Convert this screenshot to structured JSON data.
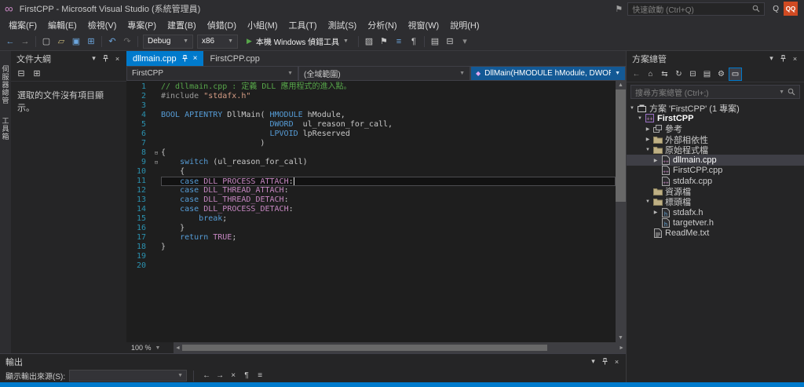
{
  "colors": {
    "accent": "#007ACC",
    "active_tab": "#007ACC",
    "editor_bg": "#1E1E1E",
    "panel_bg": "#252526",
    "statusbar": "#007ACC",
    "current_line_border": "#4D4D50"
  },
  "title_bar": {
    "title": "FirstCPP - Microsoft Visual Studio (系統管理員)",
    "flag_icon": "⚑",
    "quick_launch_placeholder": "快速啟動 (Ctrl+Q)",
    "account_initial": "Q",
    "account_badge": "QQ"
  },
  "menu_bar": {
    "items": [
      "檔案(F)",
      "編輯(E)",
      "檢視(V)",
      "專案(P)",
      "建置(B)",
      "偵錯(D)",
      "小組(M)",
      "工具(T)",
      "測試(S)",
      "分析(N)",
      "視窗(W)",
      "說明(H)"
    ]
  },
  "toolbar": {
    "icons_left": [
      {
        "name": "navigate-back-icon",
        "glyph": "←",
        "color": "#6CA6DE"
      },
      {
        "name": "navigate-forward-icon",
        "glyph": "→",
        "color": "#8A8A8A"
      },
      {
        "name": "sep"
      },
      {
        "name": "new-file-icon",
        "glyph": "▢",
        "color": "#C8C8C8"
      },
      {
        "name": "open-file-icon",
        "glyph": "▱",
        "color": "#C8B87A"
      },
      {
        "name": "save-icon",
        "glyph": "▣",
        "color": "#6CA6DE"
      },
      {
        "name": "save-all-icon",
        "glyph": "⊞",
        "color": "#6CA6DE"
      },
      {
        "name": "sep"
      },
      {
        "name": "undo-icon",
        "glyph": "↶",
        "color": "#6CA6DE"
      },
      {
        "name": "redo-icon",
        "glyph": "↷",
        "color": "#6A6A6A"
      },
      {
        "name": "sep"
      }
    ],
    "config_value": "Debug",
    "platform_value": "x86",
    "run_label": "本機 Windows 偵錯工具",
    "icons_right": [
      {
        "name": "sep"
      },
      {
        "name": "find-in-files-icon",
        "glyph": "▨",
        "color": "#C8C8C8"
      },
      {
        "name": "bookmark-icon",
        "glyph": "⚑",
        "color": "#C8C8C8"
      },
      {
        "name": "comment-lines-icon",
        "glyph": "≡",
        "color": "#6CA6DE"
      },
      {
        "name": "formatting-icon",
        "glyph": "¶",
        "color": "#C8C8C8"
      },
      {
        "name": "sep"
      },
      {
        "name": "solution-explorer-tool-icon",
        "glyph": "▤",
        "color": "#C8C8C8"
      },
      {
        "name": "properties-window-icon",
        "glyph": "⊟",
        "color": "#C8C8C8"
      },
      {
        "name": "toolbar-overflow-icon",
        "glyph": "▾",
        "color": "#8A8A8A"
      }
    ]
  },
  "autohide": {
    "items": [
      {
        "label": "伺服器總管"
      },
      {
        "label": "工具箱"
      }
    ]
  },
  "document_outline": {
    "title": "文件大綱",
    "toolbar_icons": [
      {
        "name": "collapse-all-icon",
        "glyph": "⊟",
        "color": "#C8C8C8"
      },
      {
        "name": "expand-all-icon",
        "glyph": "⊞",
        "color": "#C8C8C8"
      }
    ],
    "empty_message": "選取的文件沒有項目顯示。"
  },
  "editor": {
    "tabs": [
      {
        "label": "dllmain.cpp",
        "active": true
      },
      {
        "label": "FirstCPP.cpp",
        "active": false
      }
    ],
    "navbar": {
      "project": "FirstCPP",
      "scope": "(全域範圍)",
      "member": "DllMain(HMODULE hModule, DWORD ul_rea"
    },
    "zoom_level": "100 %",
    "code": [
      {
        "n": 1,
        "s": [
          {
            "c": "cm",
            "t": "// dllmain.cpp : 定義 DLL 應用程式的進入點。"
          }
        ]
      },
      {
        "n": 2,
        "s": [
          {
            "c": "pp",
            "t": "#include "
          },
          {
            "c": "str",
            "t": "\"stdafx.h\""
          }
        ]
      },
      {
        "n": 3,
        "s": []
      },
      {
        "n": 4,
        "s": [
          {
            "c": "kw",
            "t": "BOOL APIENTRY "
          },
          {
            "c": "pl",
            "t": "DllMain( "
          },
          {
            "c": "kw",
            "t": "HMODULE"
          },
          {
            "c": "pl",
            "t": " hModule,"
          }
        ]
      },
      {
        "n": 5,
        "s": [
          {
            "c": "pl",
            "t": "                       "
          },
          {
            "c": "kw",
            "t": "DWORD"
          },
          {
            "c": "pl",
            "t": "  ul_reason_for_call,"
          }
        ]
      },
      {
        "n": 6,
        "s": [
          {
            "c": "pl",
            "t": "                       "
          },
          {
            "c": "kw",
            "t": "LPVOID"
          },
          {
            "c": "pl",
            "t": " lpReserved"
          }
        ]
      },
      {
        "n": 7,
        "s": [
          {
            "c": "pl",
            "t": "                     )"
          }
        ]
      },
      {
        "n": 8,
        "fold": true,
        "s": [
          {
            "c": "pl",
            "t": "{"
          }
        ]
      },
      {
        "n": 9,
        "fold": true,
        "s": [
          {
            "c": "pl",
            "t": "    "
          },
          {
            "c": "kw",
            "t": "switch"
          },
          {
            "c": "pl",
            "t": " (ul_reason_for_call)"
          }
        ]
      },
      {
        "n": 10,
        "s": [
          {
            "c": "pl",
            "t": "    {"
          }
        ]
      },
      {
        "n": 11,
        "cur": true,
        "s": [
          {
            "c": "pl",
            "t": "    "
          },
          {
            "c": "kw",
            "t": "case"
          },
          {
            "c": "pl",
            "t": " "
          },
          {
            "c": "mc",
            "t": "DLL_PROCESS_ATTACH"
          },
          {
            "c": "pl",
            "t": ":"
          }
        ]
      },
      {
        "n": 12,
        "s": [
          {
            "c": "pl",
            "t": "    "
          },
          {
            "c": "kw",
            "t": "case"
          },
          {
            "c": "pl",
            "t": " "
          },
          {
            "c": "mc",
            "t": "DLL_THREAD_ATTACH"
          },
          {
            "c": "pl",
            "t": ":"
          }
        ]
      },
      {
        "n": 13,
        "s": [
          {
            "c": "pl",
            "t": "    "
          },
          {
            "c": "kw",
            "t": "case"
          },
          {
            "c": "pl",
            "t": " "
          },
          {
            "c": "mc",
            "t": "DLL_THREAD_DETACH"
          },
          {
            "c": "pl",
            "t": ":"
          }
        ]
      },
      {
        "n": 14,
        "s": [
          {
            "c": "pl",
            "t": "    "
          },
          {
            "c": "kw",
            "t": "case"
          },
          {
            "c": "pl",
            "t": " "
          },
          {
            "c": "mc",
            "t": "DLL_PROCESS_DETACH"
          },
          {
            "c": "pl",
            "t": ":"
          }
        ]
      },
      {
        "n": 15,
        "s": [
          {
            "c": "pl",
            "t": "        "
          },
          {
            "c": "kw",
            "t": "break"
          },
          {
            "c": "pl",
            "t": ";"
          }
        ]
      },
      {
        "n": 16,
        "s": [
          {
            "c": "pl",
            "t": "    }"
          }
        ]
      },
      {
        "n": 17,
        "s": [
          {
            "c": "pl",
            "t": "    "
          },
          {
            "c": "kw",
            "t": "return"
          },
          {
            "c": "pl",
            "t": " "
          },
          {
            "c": "mc",
            "t": "TRUE"
          },
          {
            "c": "pl",
            "t": ";"
          }
        ]
      },
      {
        "n": 18,
        "s": [
          {
            "c": "pl",
            "t": "}"
          }
        ]
      },
      {
        "n": 19,
        "s": []
      },
      {
        "n": 20,
        "s": []
      }
    ]
  },
  "output": {
    "title": "輸出",
    "source_label": "顯示輸出來源(S):",
    "source_value": "",
    "icons": [
      {
        "name": "previous-message-icon",
        "glyph": "←",
        "color": "#C8C8C8"
      },
      {
        "name": "next-message-icon",
        "glyph": "→",
        "color": "#C8C8C8"
      },
      {
        "name": "clear-all-icon",
        "glyph": "×",
        "color": "#C8C8C8"
      },
      {
        "name": "word-wrap-icon",
        "glyph": "¶",
        "color": "#C8C8C8"
      },
      {
        "name": "toggle-autoscroll-icon",
        "glyph": "≡",
        "color": "#C8C8C8"
      }
    ]
  },
  "solution_explorer": {
    "title": "方案總管",
    "toolbar_icons": [
      {
        "name": "back-icon",
        "glyph": "←",
        "color": "#8A8A8A"
      },
      {
        "name": "home-icon",
        "glyph": "⌂",
        "color": "#C8C8C8"
      },
      {
        "name": "switch-views-icon",
        "glyph": "⇆",
        "color": "#C8C8C8"
      },
      {
        "name": "sync-with-active-document-icon",
        "glyph": "↻",
        "color": "#C8C8C8"
      },
      {
        "name": "collapse-all-icon",
        "glyph": "⊟",
        "color": "#C8C8C8"
      },
      {
        "name": "show-all-files-icon",
        "glyph": "▤",
        "color": "#C8C8C8"
      },
      {
        "name": "properties-icon",
        "glyph": "⚙",
        "color": "#C8C8C8"
      },
      {
        "name": "preview-selected-items-icon",
        "glyph": "▭",
        "color": "#FFFFFF",
        "pressed": true
      }
    ],
    "search_placeholder": "搜尋方案總管 (Ctrl+;)",
    "tree": [
      {
        "label": "方案 'FirstCPP' (1 專案)",
        "level": 0,
        "icon": "solution",
        "expand": "down"
      },
      {
        "label": "FirstCPP",
        "level": 1,
        "icon": "project",
        "expand": "down",
        "bold": true
      },
      {
        "label": "參考",
        "level": 2,
        "icon": "references",
        "expand": "right"
      },
      {
        "label": "外部相依性",
        "level": 2,
        "icon": "folder",
        "expand": "right"
      },
      {
        "label": "原始程式檔",
        "level": 2,
        "icon": "folder",
        "expand": "down"
      },
      {
        "label": "dllmain.cpp",
        "level": 3,
        "icon": "cpp",
        "expand": "right",
        "selected": true
      },
      {
        "label": "FirstCPP.cpp",
        "level": 3,
        "icon": "cpp"
      },
      {
        "label": "stdafx.cpp",
        "level": 3,
        "icon": "cpp"
      },
      {
        "label": "資源檔",
        "level": 2,
        "icon": "folder"
      },
      {
        "label": "標頭檔",
        "level": 2,
        "icon": "folder",
        "expand": "down"
      },
      {
        "label": "stdafx.h",
        "level": 3,
        "icon": "h",
        "expand": "right"
      },
      {
        "label": "targetver.h",
        "level": 3,
        "icon": "h"
      },
      {
        "label": "ReadMe.txt",
        "level": 2,
        "icon": "txt"
      }
    ]
  },
  "status_bar": {
    "text": ""
  }
}
